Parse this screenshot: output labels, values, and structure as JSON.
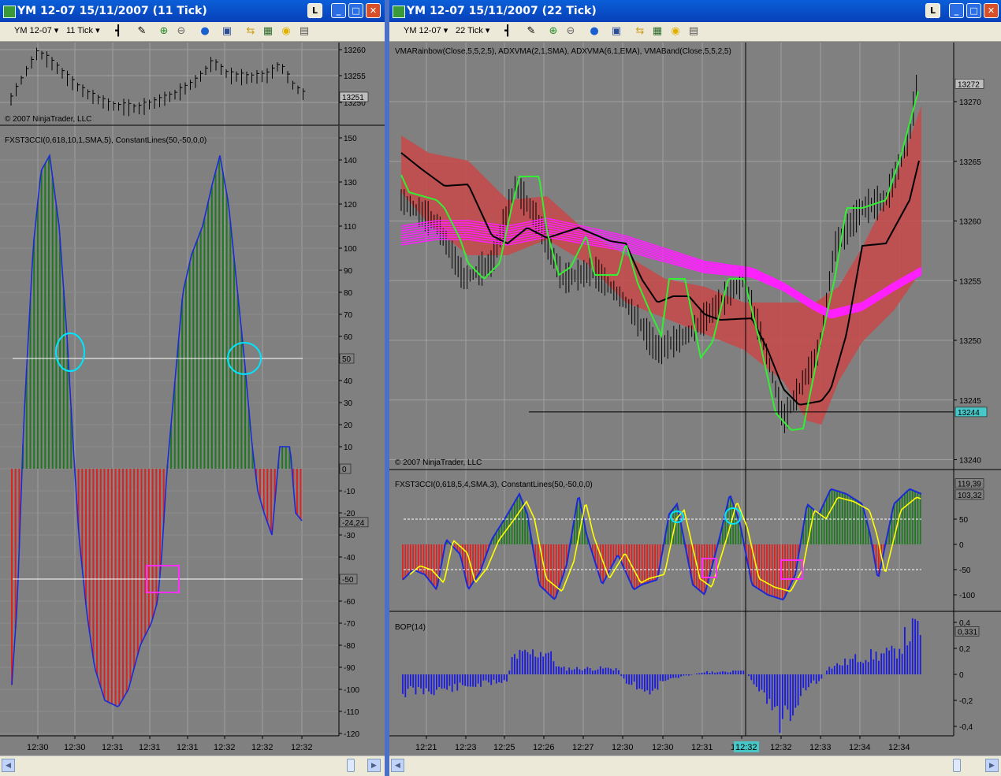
{
  "windows": {
    "left": {
      "title": "YM 12-07  15/11/2007  (11 Tick)",
      "instrument": "YM 12-07",
      "interval": "11 Tick",
      "price_panel": {
        "axis_labels": [
          "13260",
          "13255",
          "13250"
        ],
        "last_price": "13251",
        "copyright": "© 2007 NinjaTrader, LLC"
      },
      "cci_panel": {
        "label": "FXST3CCI(0,618,10,1,SMA,5), ConstantLines(50,-50,0,0)",
        "axis_labels": [
          "150",
          "140",
          "130",
          "120",
          "110",
          "100",
          "90",
          "80",
          "70",
          "60",
          "50",
          "40",
          "30",
          "20",
          "10",
          "0",
          "-10",
          "-20",
          "-30",
          "-40",
          "-50",
          "-60",
          "-70",
          "-80",
          "-90",
          "-100",
          "-110",
          "-120"
        ],
        "badges": {
          "line50": "50",
          "line0": "0",
          "line_m50": "-50",
          "last": "-24,24"
        }
      },
      "time_labels": [
        "12:30",
        "12:30",
        "12:31",
        "12:31",
        "12:31",
        "12:32",
        "12:32",
        "12:32"
      ]
    },
    "right": {
      "title": "YM 12-07  15/11/2007  (22 Tick)",
      "instrument": "YM 12-07",
      "interval": "22 Tick",
      "price_panel": {
        "label": "VMARainbow(Close,5,5,2,5), ADXVMA(2,1,SMA), ADXVMA(6,1,EMA), VMABand(Close,5,5,2,5)",
        "axis_labels": [
          "13270",
          "13265",
          "13260",
          "13255",
          "13250",
          "13245",
          "13240"
        ],
        "last_price": "13272",
        "crosshair_price": "13244",
        "copyright": "© 2007 NinjaTrader, LLC"
      },
      "cci_panel": {
        "label": "FXST3CCI(0,618,5,4,SMA,3), ConstantLines(50,-50,0,0)",
        "axis_labels": [
          "50",
          "0",
          "-50",
          "-100"
        ],
        "badges": {
          "a": "119,39",
          "b": "103,32"
        }
      },
      "bop_panel": {
        "label": "BOP(14)",
        "axis_labels": [
          "0,4",
          "0,2",
          "0",
          "-0,2",
          "-0,4"
        ],
        "badge": "0,331"
      },
      "time_labels": [
        "12:21",
        "12:23",
        "12:25",
        "12:26",
        "12:27",
        "12:30",
        "12:30",
        "12:31",
        "12:32",
        "12:32",
        "12:33",
        "12:34",
        "12:34"
      ],
      "crosshair_time": "12:32"
    }
  },
  "colors": {
    "window_bg": "#808080",
    "bull": "#1e7a1e",
    "bear": "#e02020",
    "cci_line": "#1a2ad8",
    "signal_line": "#ffff00",
    "rainbow": "#ff20ff",
    "adx_fast": "#33ee33",
    "adx_slow": "#000000",
    "band": "#c84848",
    "bop": "#1a1ae0",
    "highlight_circle": "#00e5ff",
    "highlight_box": "#ff30ff",
    "titlebar": "#0a5fd8"
  },
  "icons": [
    "bar-style-icon",
    "draw-pencil-icon",
    "zoom-in-icon",
    "zoom-out-icon",
    "globe-icon",
    "properties-icon",
    "instrument-icon",
    "chart-icon",
    "coin-icon",
    "data-box-icon"
  ]
}
